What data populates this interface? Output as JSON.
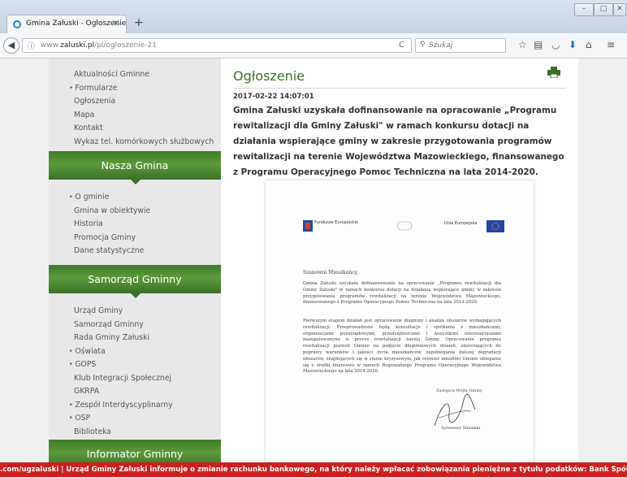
{
  "browser": {
    "tab_title": "Gmina Załuski - Ogłoszenie",
    "tab_close": "×",
    "new_tab": "+",
    "url_prefix": "www.",
    "url_domain": "zaluski.pl",
    "url_path": "/pl/ogloszenie-21",
    "search_placeholder": "Szukaj",
    "window_buttons": [
      "–",
      "□",
      "✕"
    ]
  },
  "sidebar": {
    "top_menu": [
      {
        "label": "Aktualności Gminne",
        "bullet": false
      },
      {
        "label": "Formularze",
        "bullet": true
      },
      {
        "label": "Ogłoszenia",
        "bullet": false
      },
      {
        "label": "Mapa",
        "bullet": false
      },
      {
        "label": "Kontakt",
        "bullet": false
      },
      {
        "label": "Wykaz tel. komórkowych służbowych",
        "bullet": false
      }
    ],
    "section1": {
      "title": "Nasza Gmina",
      "items": [
        {
          "label": "O gminie",
          "bullet": true
        },
        {
          "label": "Gmina w obiektywie",
          "bullet": false
        },
        {
          "label": "Historia",
          "bullet": false
        },
        {
          "label": "Promocja Gminy",
          "bullet": false
        },
        {
          "label": "Dane statystyczne",
          "bullet": false
        }
      ]
    },
    "section2": {
      "title": "Samorząd Gminny",
      "items": [
        {
          "label": "Urząd Gminy",
          "bullet": false
        },
        {
          "label": "Samorząd Gminny",
          "bullet": false
        },
        {
          "label": "Rada Gminy Załuski",
          "bullet": false
        },
        {
          "label": "Oświata",
          "bullet": true
        },
        {
          "label": "GOPS",
          "bullet": true
        },
        {
          "label": "Klub Integracji Społecznej",
          "bullet": false
        },
        {
          "label": "GKRPA",
          "bullet": false
        },
        {
          "label": "Zespół Interdyscyplinarny",
          "bullet": true
        },
        {
          "label": "OSP",
          "bullet": true
        },
        {
          "label": "Biblioteka",
          "bullet": false
        }
      ]
    },
    "section3": {
      "title": "Informator Gminny"
    }
  },
  "main": {
    "title": "Ogłoszenie",
    "date": "2017-02-22 14:07:01",
    "lead": "Gmina Załuski uzyskała dofinansowanie na opracowanie „Programu rewitalizacji dla Gminy Załuski\" w ramach konkursu dotacji na działania wspierające gminy w zakresie przygotowania programów rewitalizacji na terenie Województwa Mazowieckiego, finansowanego z Programu Operacyjnego Pomoc Techniczna na lata 2014-2020."
  },
  "document": {
    "logo_left": "Fundusze Europejskie",
    "logo_right": "Unia Europejska",
    "greeting": "Szanowni Mieszkańcy,",
    "paragraph1": "Gmina Załuski uzyskała dofinansowanie na opracowanie „Programu rewitalizacji dla Gminy Załuski\" w ramach konkursu dotacji na działania wspierające gminy w zakresie przygotowania programów rewitalizacji na terenie Województwa Mazowieckiego, finansowanego z Programu Operacyjnego Pomoc Techniczna na lata 2014-2020.",
    "paragraph2": "Pierwszym etapem działań jest opracowanie diagnozy i analiza obszarów wymagających rewitalizacji. Przeprowadzone będą konsultacje i spotkania z mieszkańcami, organizacjami pozarządowymi, przedsiębiorcami i wszystkimi interesariuszami zaangażowanymi w proces rewitalizacji naszej Gminy. Opracowanie programu rewitalizacji pozwoli Gminie na podjęcie długofalowych działań, zmierzających do poprawy warunków i jakości życia mieszkańców, zapobiegania dalszej degradacji obszarów, znajdujących się w stanie kryzysowym, jak również umożliwi Gminie ubieganie się o środki finansowe w ramach Regionalnego Programu Operacyjnego Województwa Mazowieckiego na lata 2014-2020.",
    "sign_role": "Zastępca Wójta Gminy",
    "sign_name": "Sylwester Śmiałski"
  },
  "ticker": ".com/ugzaluski    |    Urząd Gminy Załuski informuje o zmianie rachunku bankowego, na który należy wpłacać zobowiązania pieniężne z tytułu podatków: Bank Spółdzielczy",
  "colors": {
    "accent_green": "#3a7028",
    "ticker_red": "#cc1f1f"
  }
}
